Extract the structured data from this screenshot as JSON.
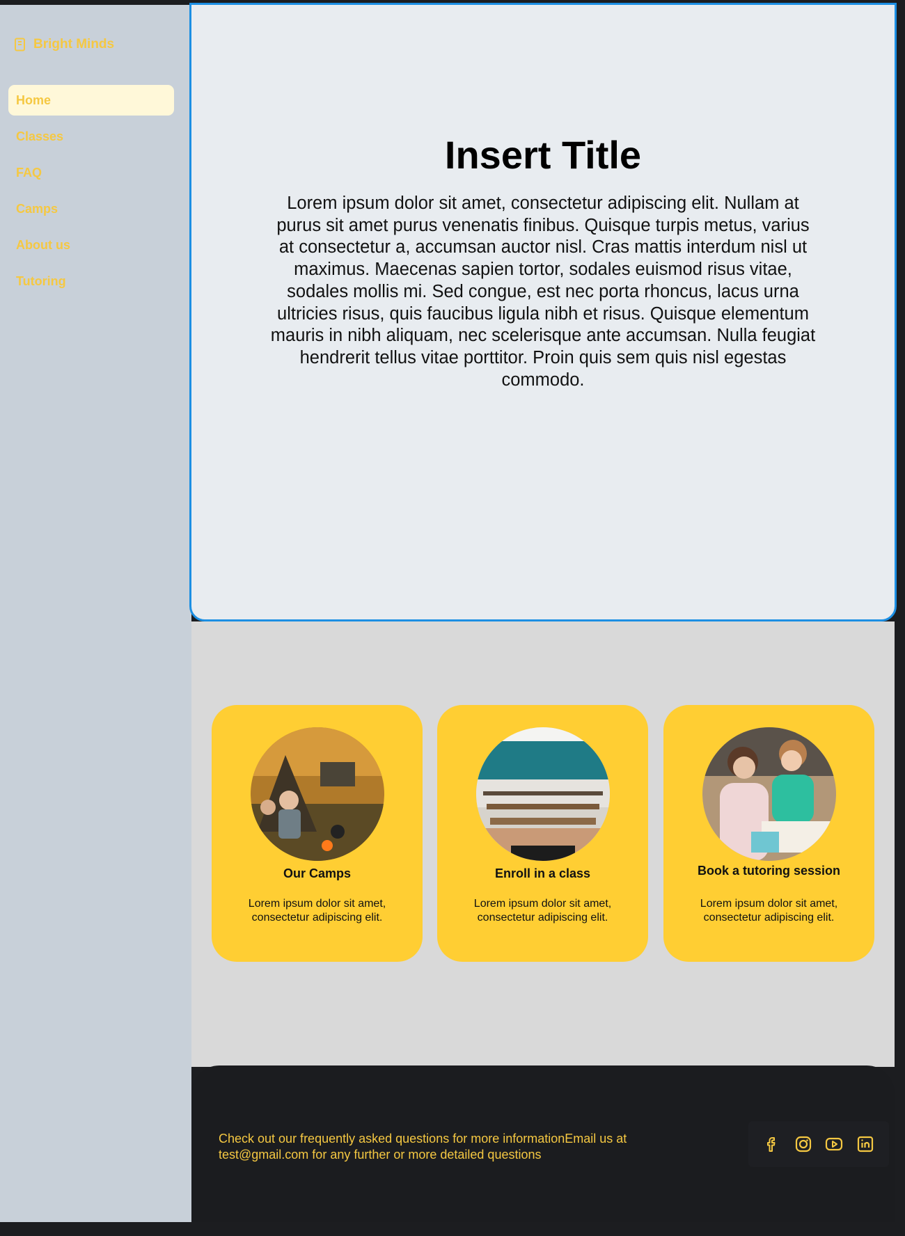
{
  "brand": {
    "name": "Bright Minds",
    "icon": "book-icon"
  },
  "nav": [
    {
      "label": "Home",
      "active": true
    },
    {
      "label": "Classes"
    },
    {
      "label": "FAQ"
    },
    {
      "label": "Camps"
    },
    {
      "label": "About us"
    },
    {
      "label": "Tutoring"
    }
  ],
  "hero": {
    "title": "Insert Title",
    "body": "Lorem ipsum dolor sit amet, consectetur adipiscing elit. Nullam at purus sit amet purus venenatis finibus. Quisque turpis metus, varius at consectetur a, accumsan auctor nisl. Cras mattis interdum nisl ut maximus. Maecenas sapien tortor, sodales euismod risus vitae, sodales mollis mi. Sed congue, est nec porta rhoncus, lacus urna ultricies risus, quis faucibus ligula nibh et risus. Quisque elementum mauris in nibh aliquam, nec scelerisque ante accumsan. Nulla feugiat hendrerit tellus vitae porttitor. Proin quis sem quis nisl egestas commodo."
  },
  "cards": [
    {
      "title": "Our Camps",
      "desc": "Lorem ipsum dolor sit amet, consectetur adipiscing elit."
    },
    {
      "title": "Enroll in a class",
      "desc": "Lorem ipsum dolor sit amet, consectetur adipiscing elit."
    },
    {
      "title": "Book a tutoring session",
      "desc": "Lorem ipsum dolor sit amet, consectetur adipiscing elit."
    }
  ],
  "footer": {
    "text": "Check out our frequently asked questions for more informationEmail us at test@gmail.com for any further or more detailed questions",
    "social": [
      "facebook-icon",
      "instagram-icon",
      "youtube-icon",
      "linkedin-icon"
    ]
  },
  "colors": {
    "accent": "#f5c842",
    "card": "#ffce33",
    "selection": "#1c8fe3"
  }
}
